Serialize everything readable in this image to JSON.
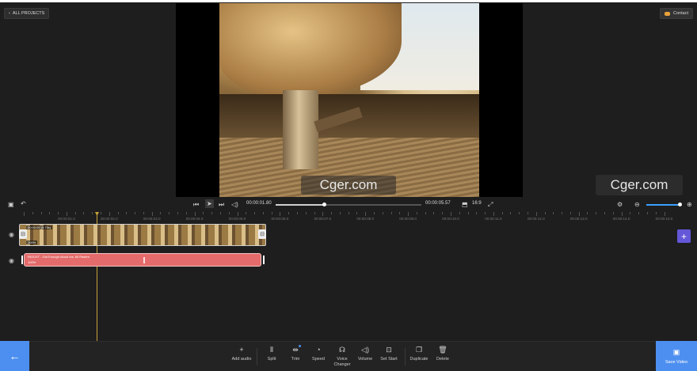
{
  "header": {
    "all_projects_label": "ALL PROJECTS",
    "contact_label": "Contact"
  },
  "preview": {
    "watermark_center": "Cger.com",
    "watermark_right": "Cger.com"
  },
  "player": {
    "current_time": "00:00:01.80",
    "total_time": "00:00:05.57",
    "progress": 0.33,
    "aspect_ratio": "16:9",
    "zoom_level": 0.95
  },
  "ruler": {
    "labels": [
      "00:00:01.0",
      "00:00:02.0",
      "00:00:03.0",
      "00:00:04.0",
      "00:00:05.0",
      "00:00:06.0",
      "00:00:07.0",
      "00:00:08.0",
      "00:00:09.0",
      "00:00:10.0",
      "00:00:11.0",
      "00:00:12.0",
      "00:00:13.0",
      "00:00:14.0",
      "00:00:15.0"
    ]
  },
  "tracks": {
    "video_clip_label": "00:00:05 (5.75s)",
    "video_clip_speed": "100%",
    "audio_clip_label": "RIOUXT - Got Enough About Ins. All Rasten",
    "audio_clip_speed": "100%"
  },
  "tools": [
    {
      "name": "add-audio",
      "label": "Add audio",
      "icon": "+"
    },
    {
      "name": "split",
      "label": "Split",
      "icon": "⫴"
    },
    {
      "name": "trim",
      "label": "Trim",
      "icon": "⇹"
    },
    {
      "name": "speed",
      "label": "Speed",
      "icon": "◔"
    },
    {
      "name": "voice-changer",
      "label": "Voice\nChanger",
      "icon": "☊"
    },
    {
      "name": "volume",
      "label": "Volume",
      "icon": "◁)"
    },
    {
      "name": "set-start",
      "label": "Set Start",
      "icon": "⊡"
    },
    {
      "name": "duplicate",
      "label": "Duplicate",
      "icon": "❐"
    },
    {
      "name": "delete",
      "label": "Delete",
      "icon": "🗑"
    }
  ],
  "footer": {
    "save_label": "Save Video"
  },
  "colors": {
    "accent": "#4d8ff0",
    "audio_clip": "#e46b6b",
    "add_track": "#6457d8",
    "playhead": "#c9a13a"
  }
}
